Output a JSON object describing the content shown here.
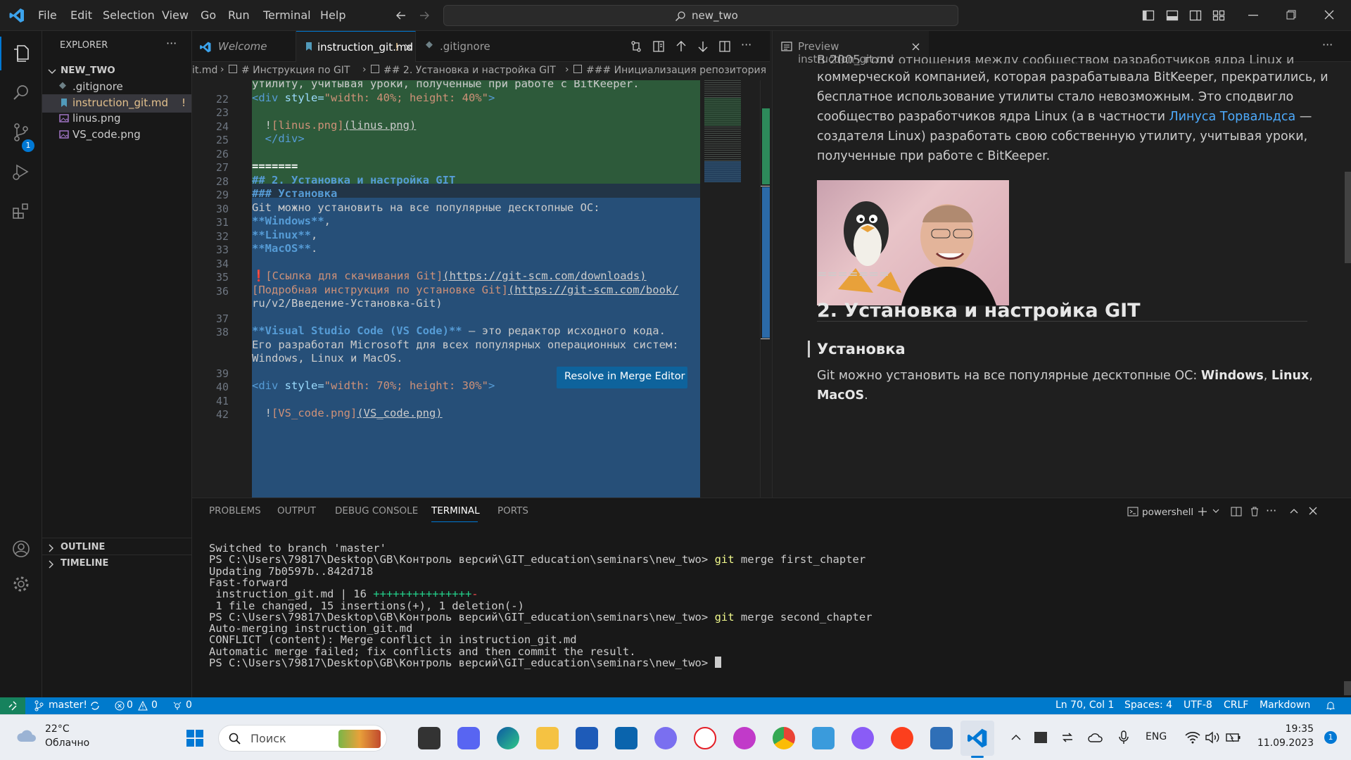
{
  "menu": [
    "File",
    "Edit",
    "Selection",
    "View",
    "Go",
    "Run",
    "Terminal",
    "Help"
  ],
  "command_center": "new_two",
  "explorer": {
    "title": "EXPLORER",
    "folder": "NEW_TWO",
    "files": [
      ".gitignore",
      "instruction_git.md",
      "linus.png",
      "VS_code.png"
    ],
    "conflict_marker": "!",
    "outline": "OUTLINE",
    "timeline": "TIMELINE"
  },
  "scm_badge": "1",
  "tabs": {
    "welcome": "Welcome",
    "active": "instruction_git.md",
    "active_marker": "!",
    "gitignore": ".gitignore"
  },
  "breadcrumb": [
    "it.md",
    "# Инструкция по GIT",
    "## 2. Установка и настройка GIT",
    "### Инициализация репозитория"
  ],
  "code_lines": [
    {
      "n": "",
      "t": "утилиту, учитывая уроки, полученные при работе с BitKeeper."
    },
    {
      "n": "22",
      "t": "<div style=\"width: 40%; height: 40%\">"
    },
    {
      "n": "23",
      "t": ""
    },
    {
      "n": "24",
      "t": "  ![linus.png](linus.png)"
    },
    {
      "n": "25",
      "t": "  </div>"
    },
    {
      "n": "26",
      "t": ""
    },
    {
      "n": "27",
      "t": "======="
    },
    {
      "n": "28",
      "t": "## 2. Установка и настройка GIT"
    },
    {
      "n": "29",
      "t": "### Установка"
    },
    {
      "n": "30",
      "t": "Git можно установить на все популярные десктопные ОС:"
    },
    {
      "n": "31",
      "t": "**Windows**,"
    },
    {
      "n": "32",
      "t": "**Linux**,"
    },
    {
      "n": "33",
      "t": "**MacOS**."
    },
    {
      "n": "34",
      "t": ""
    },
    {
      "n": "35",
      "t": "❗[Ссылка для скачивания Git](https://git-scm.com/downloads)"
    },
    {
      "n": "36",
      "t": "[Подробная инструкция по установке Git](https://git-scm.com/book/"
    },
    {
      "n": "",
      "t": "ru/v2/Введение-Установка-Git)"
    },
    {
      "n": "37",
      "t": ""
    },
    {
      "n": "38",
      "t": "**Visual Studio Code (VS Code)** — это редактор исходного кода."
    },
    {
      "n": "",
      "t": "Его разработал Microsoft для всех популярных операционных систем:"
    },
    {
      "n": "",
      "t": "Windows, Linux и MacOS."
    },
    {
      "n": "39",
      "t": ""
    },
    {
      "n": "40",
      "t": "<div style=\"width: 70%; height: 30%\">"
    },
    {
      "n": "41",
      "t": ""
    },
    {
      "n": "42",
      "t": "  ![VS_code.png](VS_code.png)"
    }
  ],
  "merge_button": "Resolve in Merge Editor",
  "preview": {
    "tab": "Preview instruction_git.md",
    "para_lines": [
      "В 2005 году отношения между сообществом разработчиков ядра Linux и",
      "коммерческой компанией, которая разрабатывала BitKeeper, прекратились, и",
      "бесплатное использование утилиты стало невозможным. Это сподвигло",
      "сообщество разработчиков ядра Linux (а в частности ",
      "создателя Linux) разработать свою собственную утилиту, учитывая уроки,",
      "полученные при работе с BitKeeper."
    ],
    "link": "Линуса Торвальдса",
    "link_suffix": " —",
    "separator": "=======",
    "h2": "2. Установка и настройка GIT",
    "h3": "Установка",
    "install_text": "Git можно установить на все популярные десктопные ОС:",
    "os1": "Windows",
    "os2": "Linux",
    "os3": "MacOS",
    "comma": ",",
    "period": "."
  },
  "panel": {
    "tabs": [
      "PROBLEMS",
      "OUTPUT",
      "DEBUG CONSOLE",
      "TERMINAL",
      "PORTS"
    ],
    "shell": "powershell",
    "prompt": "PS C:\\Users\\79817\\Desktop\\GB\\Контроль версий\\GIT_education\\seminars\\new_two>",
    "lines": [
      {
        "t": "Switched to branch 'master'"
      },
      {
        "p": true,
        "cmd": "git",
        "args": " merge first_chapter"
      },
      {
        "t": "Updating 7b0597b..842d718"
      },
      {
        "t": "Fast-forward"
      },
      {
        "t": " instruction_git.md | 16 ",
        "plus": "+++++++++++++++",
        "minus": "-"
      },
      {
        "t": " 1 file changed, 15 insertions(+), 1 deletion(-)"
      },
      {
        "p": true,
        "cmd": "git",
        "args": " merge second_chapter"
      },
      {
        "t": "Auto-merging instruction_git.md"
      },
      {
        "t": "CONFLICT (content): Merge conflict in instruction_git.md"
      },
      {
        "t": "Automatic merge failed; fix conflicts and then commit the result."
      },
      {
        "p": true,
        "cmd": "",
        "args": " "
      }
    ]
  },
  "status": {
    "branch": "master!",
    "errors": "0",
    "warnings": "0",
    "ports": "0",
    "position": "Ln 70, Col 1",
    "spaces": "Spaces: 4",
    "encoding": "UTF-8",
    "eol": "CRLF",
    "language": "Markdown"
  },
  "taskbar": {
    "temp": "22°C",
    "weather": "Облачно",
    "search": "Поиск",
    "lang": "ENG",
    "time": "19:35",
    "date": "11.09.2023",
    "notif": "1"
  },
  "colors": {
    "accent": "#007acc",
    "merge_button": "#0e639c",
    "incoming": "#264f78",
    "current": "#2d5a3a",
    "link": "#4daafc",
    "heading": "#569cd6",
    "bold": "#569cd6",
    "string": "#ce9178",
    "tag": "#569cd6",
    "cmd": "#f1fa8c"
  }
}
